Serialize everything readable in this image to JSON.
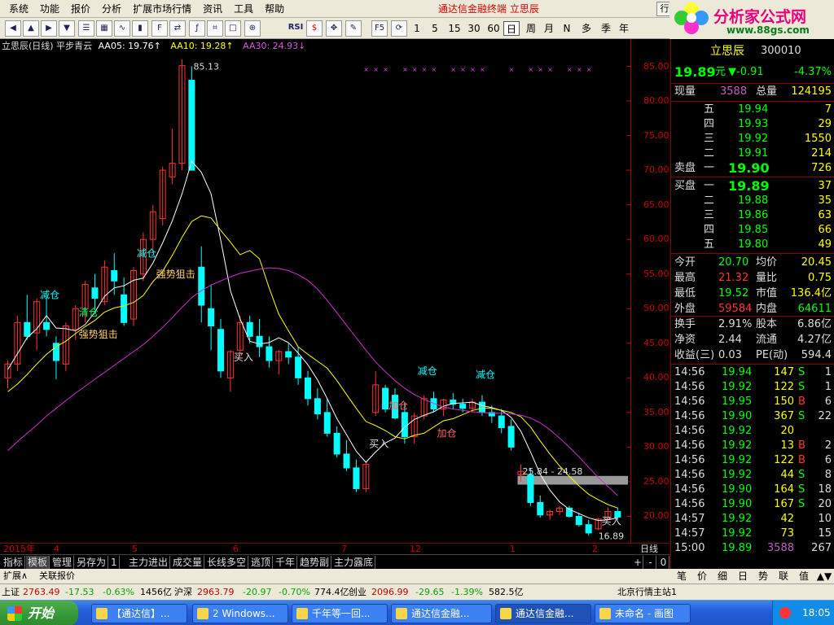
{
  "menu": [
    "系统",
    "功能",
    "报价",
    "分析",
    "扩展市场行情",
    "资讯",
    "工具",
    "帮助"
  ],
  "app_title": "通达信金融终端  立思辰",
  "window_buttons": [
    "行",
    "_",
    "□",
    "×"
  ],
  "logo": {
    "name": "分析家公式网",
    "url": "www.88gs.com"
  },
  "toolbar": {
    "icons": [
      "back-icon",
      "up-icon",
      "forward-icon",
      "down-icon",
      "stock-list-icon",
      "grid-icon",
      "line-chart-icon",
      "bar-chart-icon",
      "f10-icon",
      "compare-icon",
      "formula-icon",
      "indicator-icon",
      "window-icon",
      "zoom-icon",
      "rsi-icon",
      "dollar-icon",
      "move-icon",
      "pencil-icon",
      "f5-icon",
      "refresh-icon"
    ],
    "rsi_label": "RSI",
    "f5_label": "F5",
    "periods": [
      "1",
      "5",
      "15",
      "30",
      "60",
      "日",
      "周",
      "月",
      "N",
      "多",
      "季",
      "年"
    ],
    "selected_period": "日"
  },
  "chart_header": {
    "title": "立思辰(日线) 平步青云",
    "ma5": "AA05: 19.76",
    "ma10": "AA10: 19.28",
    "ma30": "AA30: 24.93"
  },
  "chart_data": {
    "type": "candlestick",
    "ylim": [
      17,
      88
    ],
    "y_ticks": [
      "85.00",
      "80.00",
      "75.00",
      "70.00",
      "65.00",
      "60.00",
      "55.00",
      "50.00",
      "45.00",
      "40.00",
      "35.00",
      "30.00",
      "25.00",
      "20.00"
    ],
    "x_ticks": [
      "2015年",
      "4",
      "5",
      "6",
      "7",
      "12",
      "1",
      "2",
      "日线"
    ],
    "candles": [
      [
        40,
        42.5,
        38.5,
        42
      ],
      [
        42,
        49,
        41,
        48
      ],
      [
        48,
        52,
        45.5,
        46
      ],
      [
        46.5,
        51.5,
        44,
        51
      ],
      [
        48,
        51.5,
        46,
        47
      ],
      [
        45,
        46,
        39.8,
        42.5
      ],
      [
        42,
        48,
        41,
        47.5
      ],
      [
        47,
        50.5,
        45.5,
        50
      ],
      [
        50,
        54,
        48,
        53.5
      ],
      [
        53,
        55,
        50,
        51.5
      ],
      [
        51,
        57,
        50.5,
        56
      ],
      [
        55.5,
        58,
        52,
        54
      ],
      [
        52,
        54.5,
        47.5,
        48
      ],
      [
        48.5,
        56,
        47.5,
        55.5
      ],
      [
        55,
        61,
        54,
        60
      ],
      [
        60,
        65,
        58,
        64
      ],
      [
        63,
        70.5,
        62,
        70
      ],
      [
        69,
        76,
        68,
        71
      ],
      [
        71,
        86,
        70,
        85.1
      ],
      [
        83,
        85,
        75,
        70
      ],
      [
        56,
        59,
        48,
        50.5
      ],
      [
        50,
        53.5,
        44,
        47.5
      ],
      [
        47,
        48.5,
        40,
        41
      ],
      [
        40,
        44,
        38,
        43.8
      ],
      [
        44,
        49,
        43,
        48
      ],
      [
        48,
        49,
        45,
        46
      ],
      [
        46,
        48.5,
        43,
        44.5
      ],
      [
        44.5,
        46,
        41.5,
        42.5
      ],
      [
        42.5,
        44,
        40.5,
        43.8
      ],
      [
        43.8,
        45,
        42,
        43
      ],
      [
        43,
        44.5,
        39,
        40
      ],
      [
        40,
        41,
        36,
        37
      ],
      [
        37,
        38.5,
        34,
        34.8
      ],
      [
        35,
        37,
        31.5,
        32
      ],
      [
        32,
        33,
        28.5,
        29
      ],
      [
        29,
        31,
        26.5,
        27
      ],
      [
        27,
        28.2,
        23.5,
        24
      ],
      [
        24,
        28,
        23.5,
        27.5
      ],
      [
        35,
        41,
        34.5,
        39
      ],
      [
        38.5,
        39,
        35,
        35.5
      ],
      [
        37.5,
        38.5,
        34,
        34.2
      ],
      [
        35,
        36.5,
        30.5,
        31.5
      ],
      [
        31.5,
        35,
        30.5,
        34.5
      ],
      [
        34.5,
        37.5,
        34,
        37
      ],
      [
        37,
        38,
        35,
        35.5
      ],
      [
        35.5,
        37,
        34.5,
        36.8
      ],
      [
        36.8,
        37.8,
        35.5,
        36.2
      ],
      [
        36.2,
        37,
        35,
        35.6
      ],
      [
        35.6,
        37,
        35,
        36.5
      ],
      [
        36.5,
        37.5,
        34.5,
        35
      ],
      [
        35,
        36,
        33.5,
        34.5
      ],
      [
        34.5,
        35.5,
        32,
        32.8
      ],
      [
        33,
        34,
        29.5,
        30
      ],
      [
        26,
        27.5,
        25,
        26.5
      ],
      [
        26,
        27,
        21.5,
        22
      ],
      [
        22,
        23,
        19.8,
        20.2
      ],
      [
        20.2,
        21,
        19.5,
        20.7
      ],
      [
        20.7,
        21.5,
        20.2,
        21.2
      ],
      [
        21.2,
        21.5,
        19.8,
        20
      ],
      [
        20,
        20.5,
        18.5,
        18.8
      ],
      [
        18.8,
        19.5,
        17.2,
        17.6
      ],
      [
        18.2,
        19.8,
        18,
        19.6
      ],
      [
        19.6,
        21.3,
        19.5,
        20.7
      ],
      [
        20.7,
        21.3,
        19.5,
        19.9
      ]
    ],
    "series": [
      {
        "name": "AA05",
        "values": [
          41.2,
          43.5,
          45.8,
          47.1,
          49.0,
          47.2,
          47.1,
          46.8,
          47.7,
          49.5,
          51.8,
          53.0,
          53.3,
          54.1,
          54.4,
          56.6,
          59.5,
          62.7,
          66.6,
          71.3,
          69.7,
          66.6,
          59.9,
          52.6,
          48.5,
          45.3,
          44.9,
          45.1,
          45.8,
          45.1,
          43.6,
          41.9,
          39.7,
          37.0,
          34.1,
          31.8,
          29.4,
          27.8,
          29.3,
          30.6,
          31.3,
          32.9,
          34.0,
          34.6,
          35.1,
          35.9,
          36.3,
          36.4,
          36.5,
          36.0,
          35.7,
          35.3,
          34.3,
          32.3,
          29.3,
          26.1,
          23.8,
          22.1,
          21.0,
          20.4,
          19.8,
          19.4,
          19.5,
          19.8
        ]
      },
      {
        "name": "AA10",
        "values": [
          38.0,
          39.1,
          40.5,
          42.0,
          43.4,
          44.5,
          45.3,
          46.4,
          47.4,
          48.3,
          49.5,
          50.1,
          50.4,
          50.9,
          51.9,
          53.9,
          55.4,
          57.7,
          60.3,
          62.6,
          63.4,
          63.1,
          61.3,
          59.6,
          57.8,
          58.4,
          57.2,
          53.0,
          49.2,
          46.8,
          44.5,
          43.4,
          42.4,
          41.4,
          39.6,
          37.6,
          35.6,
          33.7,
          33.1,
          32.4,
          31.5,
          31.2,
          31.7,
          32.0,
          32.9,
          33.8,
          34.1,
          34.7,
          35.3,
          35.6,
          35.6,
          35.3,
          35.0,
          34.4,
          32.9,
          30.9,
          29.0,
          27.3,
          25.8,
          24.4,
          23.2,
          22.4,
          21.7,
          21.2
        ]
      },
      {
        "name": "AA30",
        "values": [
          29.5,
          30.8,
          32.0,
          33.2,
          34.5,
          35.6,
          36.7,
          37.8,
          38.8,
          39.8,
          40.8,
          41.8,
          42.8,
          43.8,
          44.8,
          46.0,
          47.3,
          48.7,
          50.2,
          51.6,
          52.6,
          53.4,
          54.0,
          54.6,
          55.1,
          55.4,
          55.7,
          55.9,
          55.8,
          55.5,
          54.9,
          54.1,
          52.8,
          51.2,
          49.4,
          47.6,
          45.8,
          44.0,
          42.3,
          40.9,
          39.6,
          38.5,
          37.6,
          36.9,
          36.3,
          35.8,
          35.5,
          35.3,
          35.1,
          35.0,
          34.9,
          34.9,
          34.8,
          34.6,
          34.2,
          33.5,
          32.5,
          31.3,
          30.0,
          28.6,
          27.1,
          25.6,
          24.3,
          23.0
        ]
      }
    ],
    "price_labels": [
      "85.13",
      "16.89"
    ],
    "band_label": "25.84 - 24.58",
    "signals": [
      "减仓",
      "清仓",
      "强势狙击",
      "减仓",
      "强势狙击",
      "买入",
      "加仓",
      "买入",
      "减仓",
      "加仓",
      "减仓",
      "买入"
    ]
  },
  "x_axis_labels": [
    "2015年",
    "4",
    "5",
    "6",
    "7",
    "12",
    "1",
    "2"
  ],
  "period_label": "日线",
  "quote": {
    "name": "立思辰",
    "code": "300010",
    "price": "19.89",
    "unit": "元",
    "change": "▼-0.91",
    "pct": "-4.37%",
    "volume_label": "现量",
    "volume": "3588",
    "total_label": "总量",
    "total": "124195",
    "asks": [
      {
        "label": "五",
        "price": "19.94",
        "vol": "7"
      },
      {
        "label": "四",
        "price": "19.93",
        "vol": "29"
      },
      {
        "label": "三",
        "price": "19.92",
        "vol": "1550"
      },
      {
        "label": "二",
        "price": "19.91",
        "vol": "214"
      },
      {
        "label": "一",
        "price": "19.90",
        "vol": "726"
      }
    ],
    "sell_label": "卖盘",
    "buy_label": "买盘",
    "bids": [
      {
        "label": "一",
        "price": "19.89",
        "vol": "37"
      },
      {
        "label": "二",
        "price": "19.88",
        "vol": "35"
      },
      {
        "label": "三",
        "price": "19.86",
        "vol": "63"
      },
      {
        "label": "四",
        "price": "19.85",
        "vol": "66"
      },
      {
        "label": "五",
        "price": "19.80",
        "vol": "49"
      }
    ],
    "stats": [
      {
        "l1": "今开",
        "v1": "20.70",
        "l2": "均价",
        "v2": "20.45"
      },
      {
        "l1": "最高",
        "v1": "21.32",
        "l2": "量比",
        "v2": "0.75"
      },
      {
        "l1": "最低",
        "v1": "19.52",
        "l2": "市值",
        "v2": "136.4亿"
      },
      {
        "l1": "外盘",
        "v1": "59584",
        "l2": "内盘",
        "v2": "64611"
      }
    ],
    "stats2": [
      {
        "l1": "换手",
        "v1": "2.91%",
        "l2": "股本",
        "v2": "6.86亿"
      },
      {
        "l1": "净资",
        "v1": "2.44",
        "l2": "流通",
        "v2": "4.27亿"
      },
      {
        "l1": "收益(三)",
        "v1": "0.03",
        "l2": "PE(动)",
        "v2": "594.4"
      }
    ],
    "ticks": [
      [
        "14:56",
        "19.94",
        "147",
        "S",
        "1"
      ],
      [
        "14:56",
        "19.92",
        "122",
        "S",
        "1"
      ],
      [
        "14:56",
        "19.95",
        "150",
        "B",
        "6"
      ],
      [
        "14:56",
        "19.90",
        "367",
        "S",
        "22"
      ],
      [
        "14:56",
        "19.92",
        "20",
        "",
        ""
      ],
      [
        "14:56",
        "19.92",
        "13",
        "B",
        "2"
      ],
      [
        "14:56",
        "19.92",
        "122",
        "B",
        "6"
      ],
      [
        "14:56",
        "19.92",
        "44",
        "S",
        "8"
      ],
      [
        "14:56",
        "19.90",
        "164",
        "S",
        "18"
      ],
      [
        "14:56",
        "19.90",
        "167",
        "S",
        "20"
      ],
      [
        "14:57",
        "19.92",
        "42",
        "",
        "10"
      ],
      [
        "14:57",
        "19.92",
        "73",
        "",
        "15"
      ],
      [
        "15:00",
        "19.89",
        "3588",
        "",
        "267"
      ]
    ]
  },
  "bottom_tabs": [
    "指标",
    "模板",
    "管理",
    "另存为",
    "1",
    "主力进出",
    "成交量",
    "长线多空",
    "逃顶",
    "千年",
    "趋势副",
    "主力露底"
  ],
  "scroll_controls": [
    "+",
    "-",
    "0"
  ],
  "quote_tabs": [
    "笔",
    "价",
    "细",
    "日",
    "势",
    "联",
    "值",
    "▲▼"
  ],
  "extension": {
    "expand": "扩展∧",
    "link": "关联报价"
  },
  "status": {
    "sh_label": "上证",
    "sh": "2763.49",
    "sh_chg": "-17.53",
    "sh_pct": "-0.63%",
    "sh_amt": "1456亿",
    "hs_label": "沪深",
    "hs": "2963.79",
    "hs_chg": "-20.97",
    "hs_pct": "-0.70%",
    "hs_amt": "774.4亿",
    "cy_label": "创业",
    "cy": "2096.99",
    "cy_chg": "-29.65",
    "cy_pct": "-1.39%",
    "cy_amt": "582.5亿",
    "server": "北京行情主站1"
  },
  "taskbar": {
    "start": "开始",
    "tasks": [
      "【通达信】...",
      "2 Windows...",
      "千年等一回...",
      "通达信金融...",
      "通达信金融...",
      "未命名 - 画图"
    ],
    "active_task": 4,
    "clock": "18:05"
  },
  "colors": {
    "up": "#ff3333",
    "down": "#00ffff",
    "ma5": "#ffffff",
    "ma10": "#ffff00",
    "ma30": "#cc33cc",
    "axis": "#cc0000"
  }
}
